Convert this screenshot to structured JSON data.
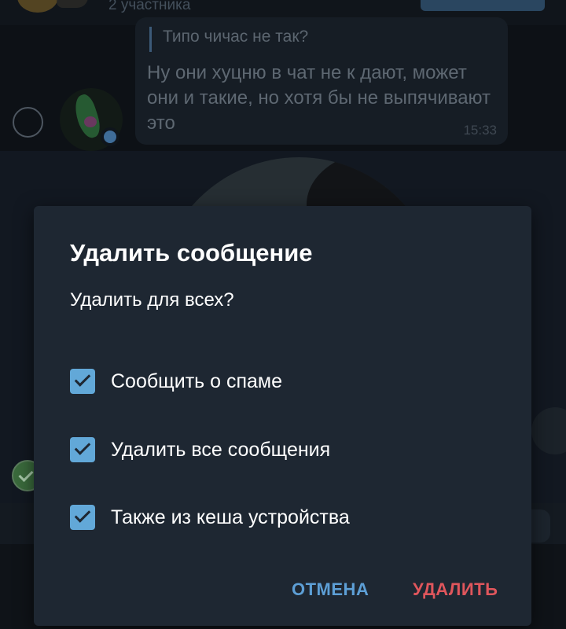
{
  "chat": {
    "participants": "2 участника",
    "message": {
      "reply_quote": "Типо чичас не так?",
      "text": "Ну они хуцню в чат не к дают, может они и такие, но хотя бы не выпячивают это",
      "time": "15:33"
    }
  },
  "dialog": {
    "title": "Удалить сообщение",
    "question": "Удалить для всех?",
    "options": [
      {
        "label": "Сообщить о спаме",
        "checked": true
      },
      {
        "label": "Удалить все сообщения",
        "checked": true
      },
      {
        "label": "Также из кеша устройства",
        "checked": true
      }
    ],
    "cancel_label": "ОТМЕНА",
    "delete_label": "УДАЛИТЬ"
  },
  "colors": {
    "dialog_bg": "#1e2732",
    "checkbox": "#62a8d8",
    "cancel": "#5d9fd6",
    "delete": "#e0565c"
  }
}
